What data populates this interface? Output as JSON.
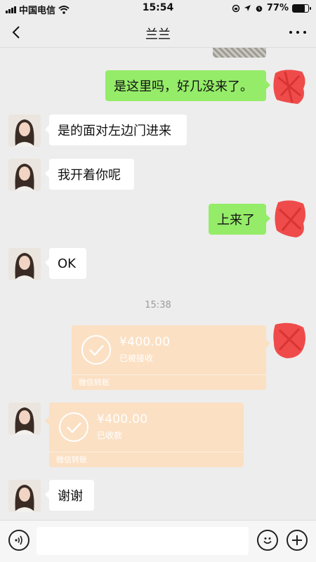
{
  "status_bar": {
    "carrier": "中国电信",
    "time": "15:54",
    "battery_percent": "77%",
    "battery_level": 0.77
  },
  "header": {
    "title": "兰兰"
  },
  "messages": {
    "m1": "是这里吗，好几没来了。",
    "m2": "是的面对左边门进来",
    "m3": "我开着你呢",
    "m4": "上来了",
    "m5": "OK",
    "timestamp": "15:38",
    "transfer_sent": {
      "amount": "¥400.00",
      "status": "已被接收",
      "label": "微信转账"
    },
    "transfer_received": {
      "amount": "¥400.00",
      "status": "已收款",
      "label": "微信转账"
    },
    "m6": "谢谢"
  },
  "input_bar": {
    "placeholder": "",
    "value": ""
  },
  "colors": {
    "background": "#ededed",
    "outgoing_bubble": "#95ec69",
    "incoming_bubble": "#ffffff",
    "transfer_bubble": "#fbe0c4",
    "redaction": "#ef4b4b"
  },
  "icons": [
    "cellular-signal-icon",
    "wifi-icon",
    "orientation-lock-icon",
    "location-arrow-icon",
    "alarm-icon",
    "battery-icon",
    "back-chevron-icon",
    "more-dots-icon",
    "check-circle-icon",
    "voice-icon",
    "emoji-icon",
    "plus-icon"
  ]
}
